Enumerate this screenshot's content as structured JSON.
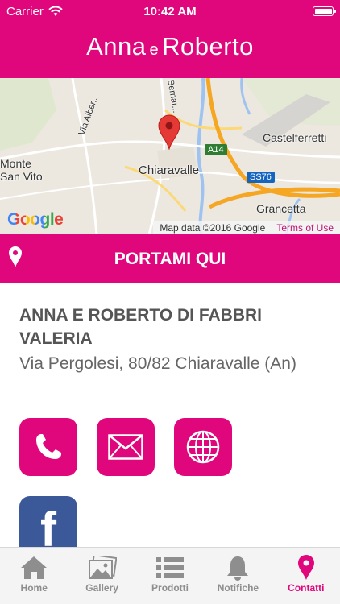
{
  "status_bar": {
    "carrier": "Carrier",
    "time": "10:42 AM"
  },
  "header": {
    "title_left": "Anna",
    "title_mid": "e",
    "title_right": "Roberto"
  },
  "map": {
    "labels": {
      "via_alberici": "Via Alber...",
      "s_bernardo": "S. Bernar...",
      "castelferretti": "Castelferretti",
      "a14": "A14",
      "monte": "Monte",
      "san_vito": "San Vito",
      "chiaravalle": "Chiaravalle",
      "ss76": "SS76",
      "grancetta": "Grancetta"
    },
    "google": "Google",
    "attribution": "Map data ©2016 Google",
    "terms": "Terms of Use"
  },
  "navigate": {
    "label": "PORTAMI QUI",
    "icon": "location-pin-icon"
  },
  "business": {
    "name": "ANNA E ROBERTO DI FABBRI VALERIA",
    "address": "Via Pergolesi, 80/82 Chiaravalle (An)"
  },
  "actions": [
    {
      "icon": "phone-icon"
    },
    {
      "icon": "mail-icon"
    },
    {
      "icon": "globe-icon"
    },
    {
      "icon": "facebook-icon",
      "letter": "f"
    }
  ],
  "tabs": [
    {
      "label": "Home",
      "icon": "home-icon"
    },
    {
      "label": "Gallery",
      "icon": "gallery-icon"
    },
    {
      "label": "Prodotti",
      "icon": "list-icon"
    },
    {
      "label": "Notifiche",
      "icon": "bell-icon"
    },
    {
      "label": "Contatti",
      "icon": "location-pin-icon",
      "active": true
    }
  ],
  "colors": {
    "brand": "#e0077d",
    "facebook": "#3b5998",
    "inactive_tab": "#8e8e8e"
  }
}
